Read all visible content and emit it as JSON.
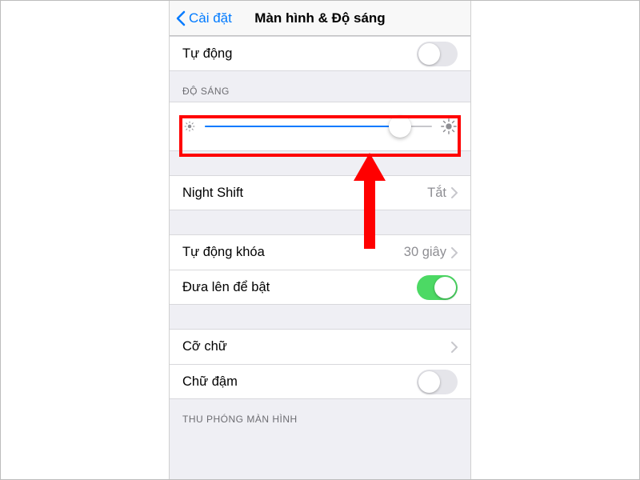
{
  "nav": {
    "back_label": "Cài đặt",
    "title": "Màn hình & Độ sáng"
  },
  "rows": {
    "auto_brightness": "Tự động",
    "brightness_header": "ĐỘ SÁNG",
    "night_shift_label": "Night Shift",
    "night_shift_value": "Tắt",
    "auto_lock_label": "Tự động khóa",
    "auto_lock_value": "30 giây",
    "raise_to_wake": "Đưa lên để bật",
    "text_size": "Cỡ chữ",
    "bold_text": "Chữ đậm",
    "zoom_header": "THU PHÓNG MÀN HÌNH"
  },
  "slider": {
    "percent": 86
  },
  "switches": {
    "auto_brightness_on": false,
    "raise_to_wake_on": true,
    "bold_text_on": false
  }
}
